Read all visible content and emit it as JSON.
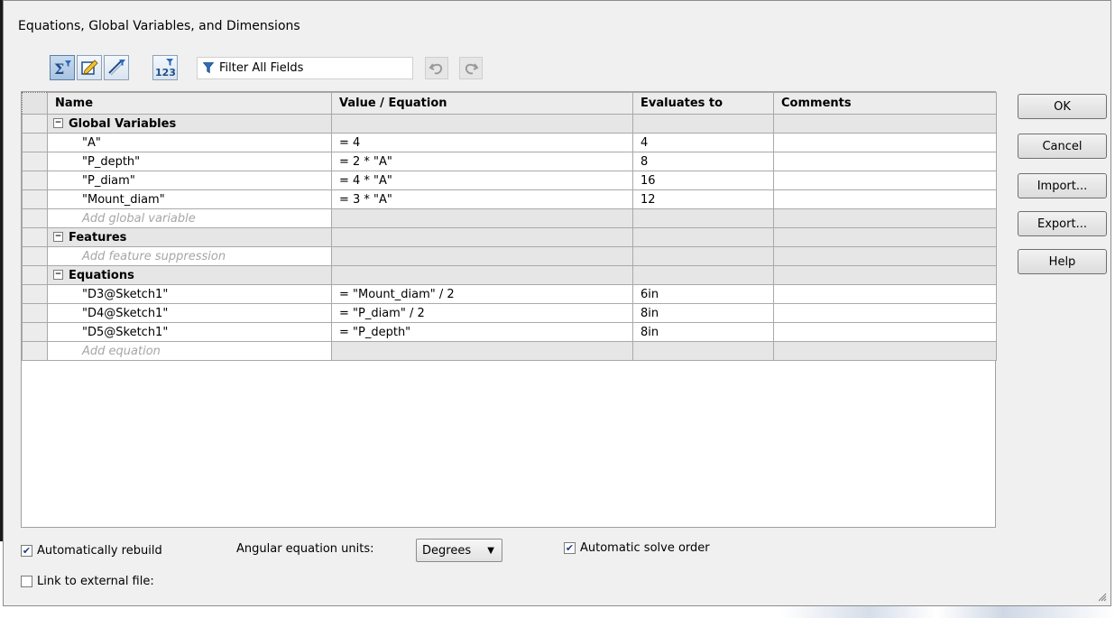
{
  "window": {
    "title": "Equations, Global Variables, and Dimensions"
  },
  "toolbar": {
    "filter_label": "Filter All Fields",
    "buttons": [
      "equation-view-icon",
      "sketch-equation-view-icon",
      "dimension-view-icon",
      "ordered-view-icon",
      "undo-icon",
      "redo-icon"
    ]
  },
  "table": {
    "headers": [
      "Name",
      "Value / Equation",
      "Evaluates to",
      "Comments"
    ],
    "sections": [
      {
        "label": "Global Variables",
        "rows": [
          {
            "name": "\"A\"",
            "value": "= 4",
            "evaluates": "4",
            "comment": ""
          },
          {
            "name": "\"P_depth\"",
            "value": "= 2 * \"A\"",
            "evaluates": "8",
            "comment": ""
          },
          {
            "name": "\"P_diam\"",
            "value": "= 4 * \"A\"",
            "evaluates": "16",
            "comment": ""
          },
          {
            "name": "\"Mount_diam\"",
            "value": "= 3 * \"A\"",
            "evaluates": "12",
            "comment": ""
          }
        ],
        "add_label": "Add global variable"
      },
      {
        "label": "Features",
        "rows": [],
        "add_label": "Add feature suppression"
      },
      {
        "label": "Equations",
        "rows": [
          {
            "name": "\"D3@Sketch1\"",
            "value": "= \"Mount_diam\" / 2",
            "evaluates": "6in",
            "comment": ""
          },
          {
            "name": "\"D4@Sketch1\"",
            "value": "= \"P_diam\" / 2",
            "evaluates": "8in",
            "comment": ""
          },
          {
            "name": "\"D5@Sketch1\"",
            "value": "= \"P_depth\"",
            "evaluates": "8in",
            "comment": ""
          }
        ],
        "add_label": "Add equation"
      }
    ]
  },
  "buttons": {
    "ok": "OK",
    "cancel": "Cancel",
    "import": "Import...",
    "export": "Export...",
    "help": "Help"
  },
  "options": {
    "auto_rebuild": {
      "label": "Automatically rebuild",
      "checked": true
    },
    "link_external": {
      "label": "Link to external file:",
      "checked": false
    },
    "angular_units_label": "Angular equation units:",
    "angular_units_value": "Degrees",
    "auto_solve": {
      "label": "Automatic solve order",
      "checked": true
    }
  }
}
